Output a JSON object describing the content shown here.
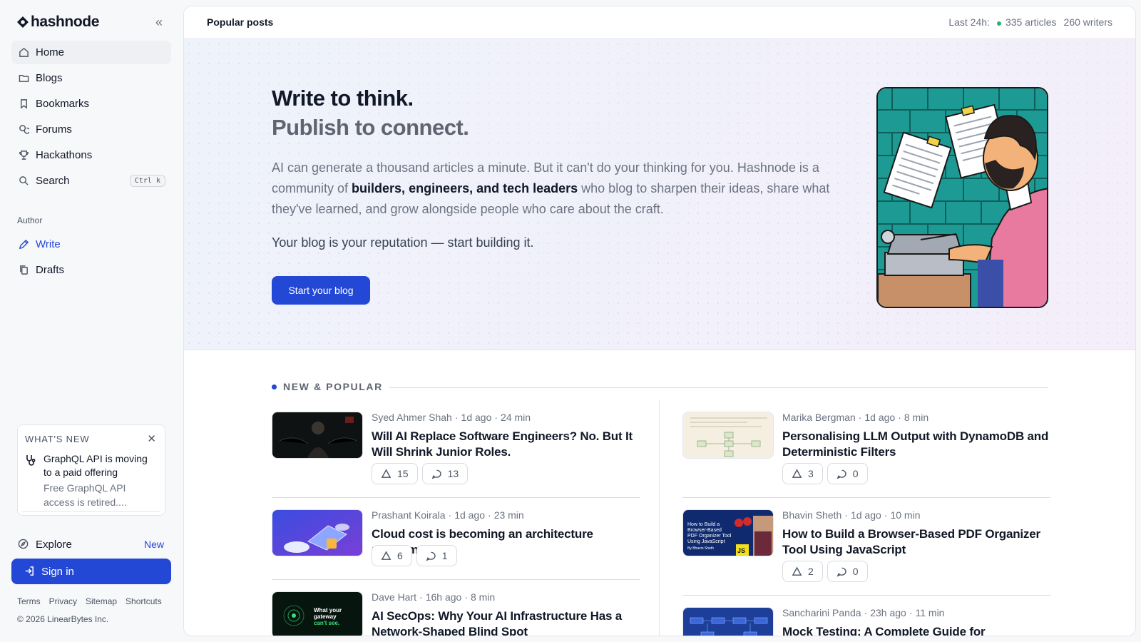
{
  "sidebar": {
    "logo_text": "hashnode",
    "nav": [
      {
        "label": "Home",
        "icon": "home-icon"
      },
      {
        "label": "Blogs",
        "icon": "folder-icon"
      },
      {
        "label": "Bookmarks",
        "icon": "bookmark-icon"
      },
      {
        "label": "Forums",
        "icon": "forums-icon"
      },
      {
        "label": "Hackathons",
        "icon": "trophy-icon"
      },
      {
        "label": "Search",
        "icon": "search-icon",
        "shortcut": "Ctrl k"
      }
    ],
    "author_section": "Author",
    "author_nav": [
      {
        "label": "Write",
        "icon": "pen-icon"
      },
      {
        "label": "Drafts",
        "icon": "drafts-icon"
      }
    ],
    "whats_new": {
      "heading": "WHAT'S NEW",
      "title": "GraphQL API is moving to a paid offering",
      "description": "Free GraphQL API access is retired...."
    },
    "explore": {
      "label": "Explore",
      "badge": "New"
    },
    "sign_in": "Sign in",
    "footer_links": [
      "Terms",
      "Privacy",
      "Sitemap",
      "Shortcuts"
    ],
    "copyright": "© 2026 LinearBytes Inc."
  },
  "topbar": {
    "title": "Popular posts",
    "stats_label": "Last 24h:",
    "articles": "335 articles",
    "writers": "260 writers"
  },
  "hero": {
    "headline_1": "Write to think.",
    "headline_2": "Publish to connect.",
    "paragraph_1": "AI can generate a thousand articles a minute. But it can't do your thinking for you. Hashnode is a community of ",
    "paragraph_bold": "builders, engineers, and tech leaders",
    "paragraph_2": " who blog to sharpen their ideas, share what they've learned, and grow alongside people who care about the craft.",
    "tagline": "Your blog is your reputation — start building it.",
    "cta": "Start your blog"
  },
  "feed": {
    "section_title": "NEW & POPULAR",
    "posts": [
      {
        "author": "Syed Ahmer Shah",
        "time": "1d ago",
        "read": "24 min",
        "title": "Will AI Replace Software Engineers? No. But It Will Shrink Junior Roles.",
        "likes": "15",
        "comments": "13"
      },
      {
        "author": "Marika Bergman",
        "time": "1d ago",
        "read": "8 min",
        "title": "Personalising LLM Output with DynamoDB and Deterministic Filters",
        "likes": "3",
        "comments": "0"
      },
      {
        "author": "Prashant Koirala",
        "time": "1d ago",
        "read": "23 min",
        "title": "Cloud cost is becoming an architecture problem",
        "likes": "6",
        "comments": "1"
      },
      {
        "author": "Bhavin Sheth",
        "time": "1d ago",
        "read": "10 min",
        "title": "How to Build a Browser-Based PDF Organizer Tool Using JavaScript",
        "likes": "2",
        "comments": "0"
      },
      {
        "author": "Dave Hart",
        "time": "16h ago",
        "read": "8 min",
        "title": "AI SecOps: Why Your AI Infrastructure Has a Network-Shaped Blind Spot"
      },
      {
        "author": "Sancharini Panda",
        "time": "23h ago",
        "read": "11 min",
        "title": "Mock Testing: A Complete Guide for Developers"
      }
    ],
    "thumb_text": {
      "secops": [
        "What your",
        "gateway",
        "can't see."
      ],
      "pdf": [
        "How to Build a",
        "Browser-Based",
        "PDF Organizer Tool",
        "Using JavaScript",
        "By Bhavin Sheth",
        "JS"
      ]
    }
  },
  "colors": {
    "accent": "#2448d6",
    "online": "#22b573"
  }
}
